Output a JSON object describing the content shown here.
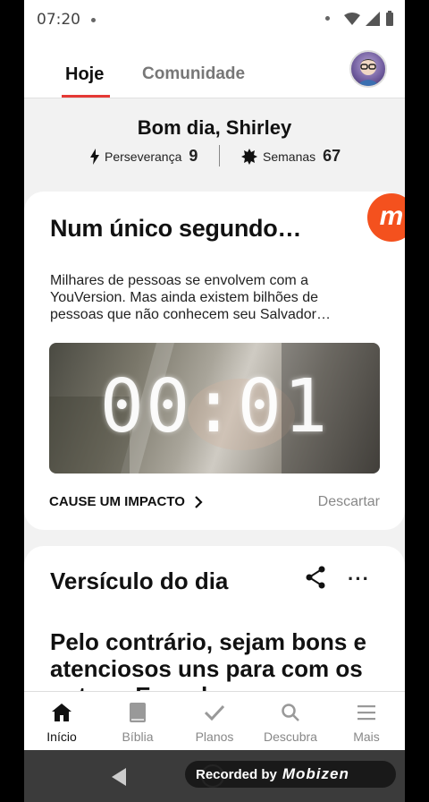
{
  "status": {
    "time": "07:20"
  },
  "tabs": {
    "today": "Hoje",
    "community": "Comunidade"
  },
  "greeting": "Bom dia, Shirley",
  "stats": {
    "perseverance_label": "Perseverança",
    "perseverance_value": "9",
    "weeks_label": "Semanas",
    "weeks_value": "67"
  },
  "impact_card": {
    "title": "Num único segundo…",
    "body": "Milhares de pessoas se envolvem com a YouVersion. Mas ainda existem bilhões de pessoas que não conhecem seu Salvador…",
    "video_timer": "00:01",
    "cta": "CAUSE UM IMPACTO",
    "dismiss": "Descartar"
  },
  "verse_card": {
    "title": "Versículo do dia",
    "more": "···",
    "verse_text": "Pelo contrário, sejam bons e atenciosos uns para com os outros. E perdoem"
  },
  "bottom_nav": [
    {
      "label": "Início",
      "icon": "home-icon"
    },
    {
      "label": "Bíblia",
      "icon": "bible-icon"
    },
    {
      "label": "Planos",
      "icon": "check-icon"
    },
    {
      "label": "Descubra",
      "icon": "search-icon"
    },
    {
      "label": "Mais",
      "icon": "menu-icon"
    }
  ],
  "recorder": {
    "prefix": "Recorded by",
    "brand": "Mobizen",
    "badge": "m"
  },
  "colors": {
    "accent": "#e53935",
    "recorder": "#f4511e"
  }
}
